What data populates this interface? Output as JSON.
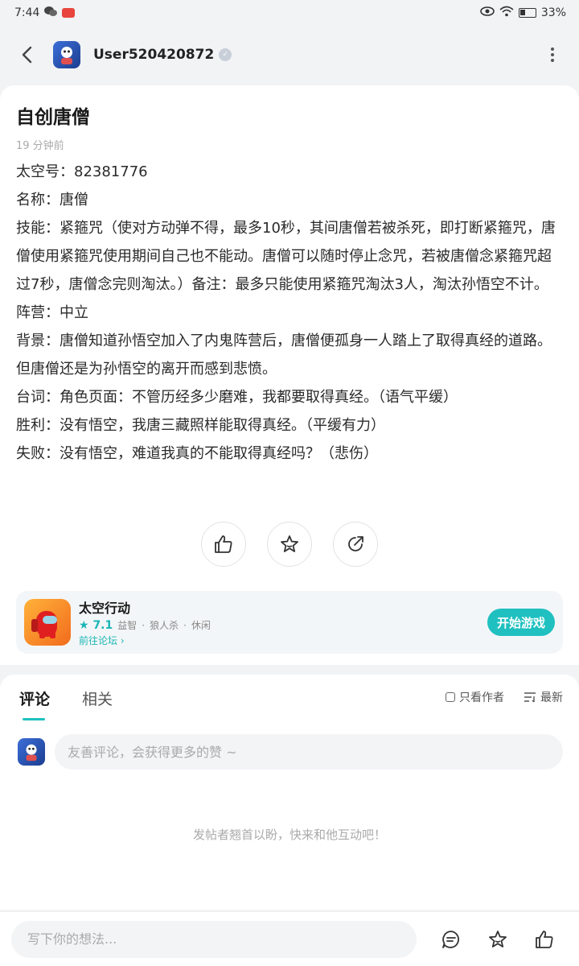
{
  "status_bar": {
    "time": "7:44",
    "battery": "33%"
  },
  "header": {
    "user_name": "User520420872"
  },
  "post": {
    "title": "自创唐僧",
    "time_ago": "19 分钟前",
    "lines": {
      "space_id": "太空号：82381776",
      "name": "名称：唐僧",
      "skill": "技能：紧箍咒（使对方动弹不得，最多10秒，其间唐僧若被杀死，即打断紧箍咒，唐僧使用紧箍咒使用期间自己也不能动。唐僧可以随时停止念咒，若被唐僧念紧箍咒超过7秒，唐僧念完则淘汰。）备注：最多只能使用紧箍咒淘汰3人，淘汰孙悟空不计。",
      "camp": "阵营：中立",
      "background": "背景：唐僧知道孙悟空加入了内鬼阵营后，唐僧便孤身一人踏上了取得真经的道路。但唐僧还是为孙悟空的离开而感到悲愤。",
      "lines_role": "台词：角色页面：不管历经多少磨难，我都要取得真经。（语气平缓）",
      "victory": "胜利：没有悟空，我唐三藏照样能取得真经。（平缓有力）",
      "defeat": "失败：没有悟空，难道我真的不能取得真经吗？（悲伤）"
    }
  },
  "game": {
    "name": "太空行动",
    "rating": "7.1",
    "tags": [
      "益智",
      "狼人杀",
      "休闲"
    ],
    "forum_link": "前往论坛",
    "play_label": "开始游戏"
  },
  "comments": {
    "tabs": [
      "评论",
      "相关"
    ],
    "filter_author": "只看作者",
    "filter_sort": "最新",
    "input_placeholder": "友善评论，会获得更多的赞 ~",
    "empty_text": "发帖者翘首以盼，快来和他互动吧！"
  },
  "bottom_bar": {
    "input_placeholder": "写下你的想法..."
  },
  "colors": {
    "accent": "#20c0c0",
    "background": "#f2f3f5"
  }
}
